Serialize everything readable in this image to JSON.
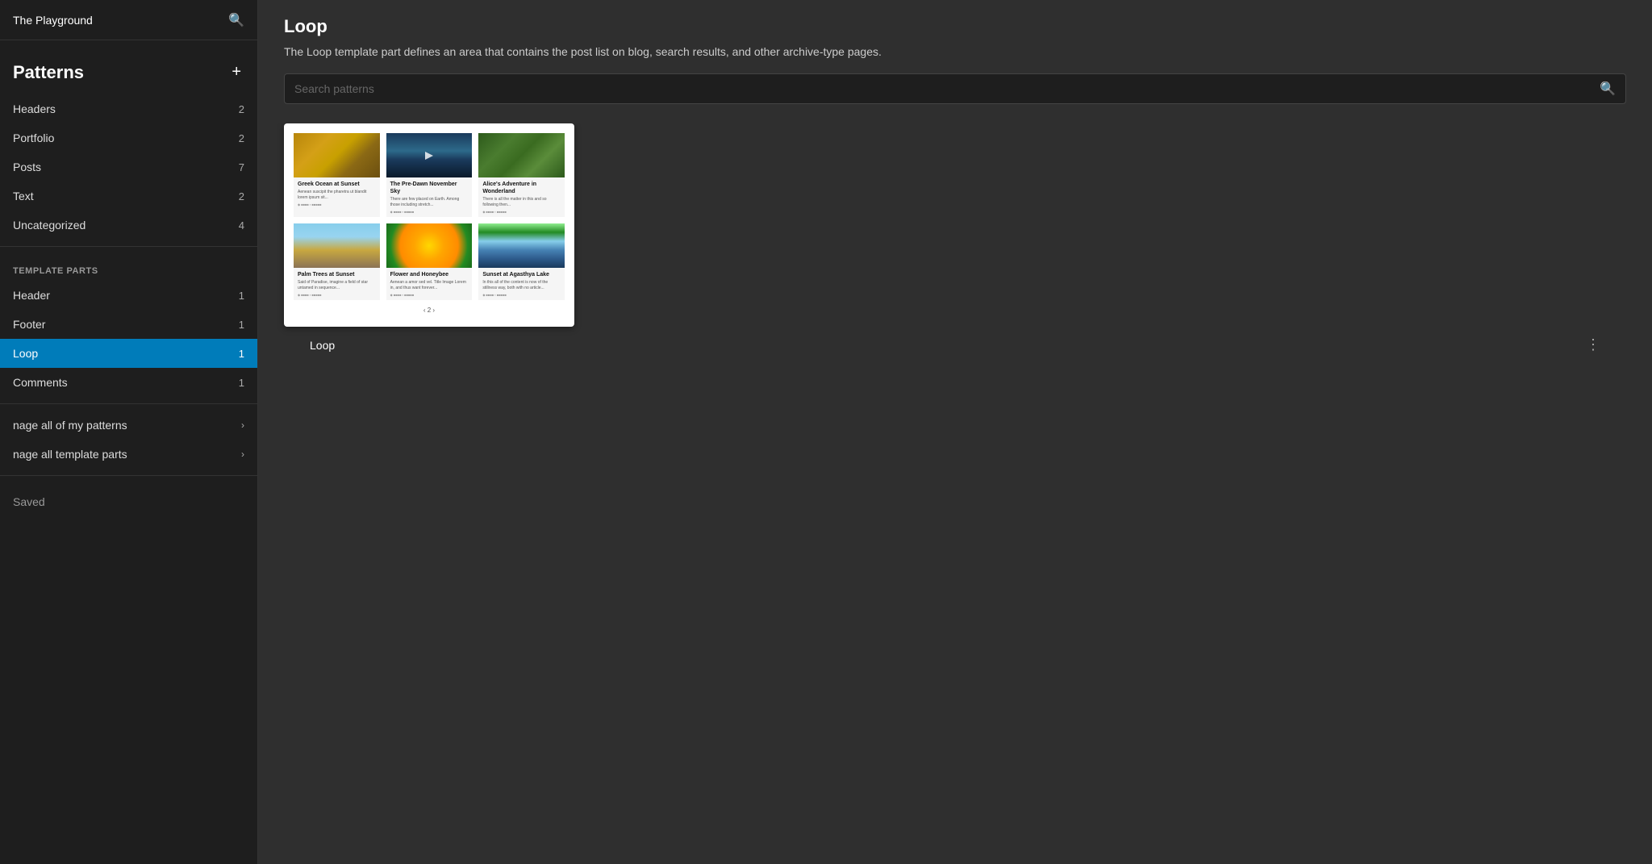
{
  "sidebar": {
    "site_title": "The Playground",
    "patterns_title": "Patterns",
    "add_label": "+",
    "nav_items": [
      {
        "label": "Headers",
        "count": 2
      },
      {
        "label": "Portfolio",
        "count": 2
      },
      {
        "label": "Posts",
        "count": 7
      },
      {
        "label": "Text",
        "count": 2
      },
      {
        "label": "Uncategorized",
        "count": 4
      }
    ],
    "template_parts_label": "TEMPLATE PARTS",
    "template_parts": [
      {
        "label": "Header",
        "count": 1
      },
      {
        "label": "Footer",
        "count": 1
      },
      {
        "label": "Loop",
        "count": 1,
        "active": true
      },
      {
        "label": "Comments",
        "count": 1
      }
    ],
    "manage_links": [
      {
        "label": "nage all of my patterns"
      },
      {
        "label": "nage all template parts"
      }
    ],
    "saved_label": "Saved"
  },
  "main": {
    "title": "Loop",
    "description": "The Loop template part defines an area that contains the post list on blog, search results, and other archive-type pages.",
    "search_placeholder": "Search patterns",
    "card_label": "Loop",
    "blog_posts": [
      {
        "id": 1,
        "title": "Greek Ocean at Sunset",
        "text": "Aenean suscipit the pharetra ut blandit. Lorem ipsum",
        "img_type": "ocean"
      },
      {
        "id": 2,
        "title": "The Pre-Dawn November Sky",
        "text": "There are few places on Earth. Among those places is including stretch.",
        "img_type": "dawn"
      },
      {
        "id": 3,
        "title": "Alice's Adventure in Wonderland",
        "text": "There is all the matter in this and so following then.",
        "img_type": "wonderland"
      },
      {
        "id": 4,
        "title": "Palm Trees at Sunset",
        "text": "Said of Paradise - imagine a field of star, untamed in sequence of necessity.",
        "img_type": "palmtrees"
      },
      {
        "id": 5,
        "title": "Flower and Honeybee",
        "text": "Aenean a amor sed vel. Title Image Lorem in, and thus want forever.",
        "img_type": "flower"
      },
      {
        "id": 6,
        "title": "Sunset at Agasthya Lake",
        "text": "In this all of the contentis now of the the stillness way, both with no article.",
        "img_type": "lake"
      }
    ]
  }
}
